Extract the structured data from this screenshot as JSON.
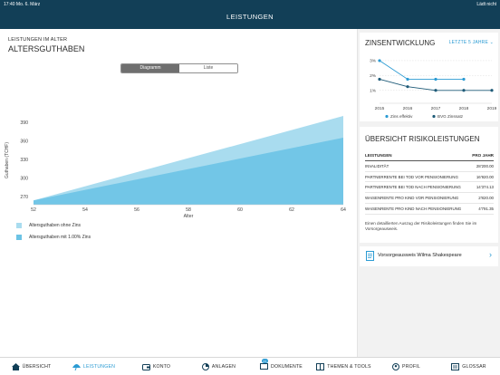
{
  "status_bar": {
    "time_date": "17:40   Mo. 6. März",
    "battery": "Lädt nicht"
  },
  "header": {
    "title": "LEISTUNGEN"
  },
  "main": {
    "eyebrow": "LEISTUNGEN IM ALTER",
    "title": "ALTERSGUTHABEN",
    "segments": {
      "diagram": "Diagramm",
      "list": "Liste",
      "selected": "Diagramm"
    },
    "legend": [
      {
        "label": "Altersguthaben ohne Zins",
        "color": "#a9dcef"
      },
      {
        "label": "Altersguthaben mit 1.00% Zins",
        "color": "#6cc3e5"
      }
    ]
  },
  "chart_data": [
    {
      "type": "area",
      "xlabel": "Alter",
      "ylabel": "Guthaben (TCHF)",
      "x_ticks": [
        "52",
        "54",
        "56",
        "58",
        "60",
        "62",
        "64"
      ],
      "y_ticks": [
        "270",
        "300",
        "330",
        "360",
        "390"
      ],
      "xlim": [
        52,
        64
      ],
      "ylim": [
        257,
        400
      ],
      "series": [
        {
          "name": "Altersguthaben ohne Zins",
          "color": "#a9dcef",
          "x": [
            52,
            64
          ],
          "y": [
            264,
            400
          ]
        },
        {
          "name": "Altersguthaben mit 1.00% Zins",
          "color": "#6cc3e5",
          "x": [
            52,
            64
          ],
          "y": [
            264,
            365
          ]
        }
      ]
    },
    {
      "type": "line",
      "title": "ZINSENTWICKLUNG",
      "x_ticks": [
        "2015",
        "2016",
        "2017",
        "2018",
        "2019"
      ],
      "y_ticks": [
        "3%",
        "2%",
        "1%"
      ],
      "ylim": [
        0.5,
        3.3
      ],
      "series": [
        {
          "name": "Zins effektiv",
          "color": "#2b9bd3",
          "x": [
            2015,
            2016,
            2017,
            2018
          ],
          "y": [
            3.0,
            1.75,
            1.75,
            1.75
          ]
        },
        {
          "name": "BVG Zinssatz",
          "color": "#1f5b78",
          "x": [
            2015,
            2016,
            2017,
            2018,
            2019
          ],
          "y": [
            1.75,
            1.25,
            1.0,
            1.0,
            1.0
          ]
        }
      ]
    }
  ],
  "zins": {
    "title": "ZINSENTWICKLUNG",
    "period": "LETZTE 5 JAHRE",
    "legend1": "Zins effektiv",
    "legend2": "BVG Zinssatz"
  },
  "risk": {
    "title": "ÜBERSICHT RISIKOLEISTUNGEN",
    "headers": [
      "LEISTUNGEN",
      "PRO JAHR"
    ],
    "rows": [
      {
        "label": "INVALIDITÄT",
        "value": "28'200.00"
      },
      {
        "label": "PARTNERRENTE BEI TOD VOR PENSIONIERUNG",
        "value": "16'920.00"
      },
      {
        "label": "PARTNERRENTE BEI TOD NACH PENSIONIERUNG",
        "value": "14'374.13"
      },
      {
        "label": "WAISENRENTE PRO KIND VOR PENSIONIERUNG",
        "value": "2'820.00"
      },
      {
        "label": "WAISENRENTE PRO KIND NACH PENSIONIERUNG",
        "value": "4'791.35"
      }
    ],
    "footnote": "Einen detaillierten Auszug der Risikoleistungen finden Sie im Vorsorgeausweis."
  },
  "doc": {
    "label": "Vorsorgeausweis Wilma Shakespeare"
  },
  "tabbar": {
    "active": "LEISTUNGEN",
    "items": [
      "ÜBERSICHT",
      "LEISTUNGEN",
      "KONTO",
      "ANLAGEN",
      "DOKUMENTE",
      "THEMEN & TOOLS",
      "PROFIL",
      "GLOSSAR"
    ],
    "badge": "11"
  }
}
